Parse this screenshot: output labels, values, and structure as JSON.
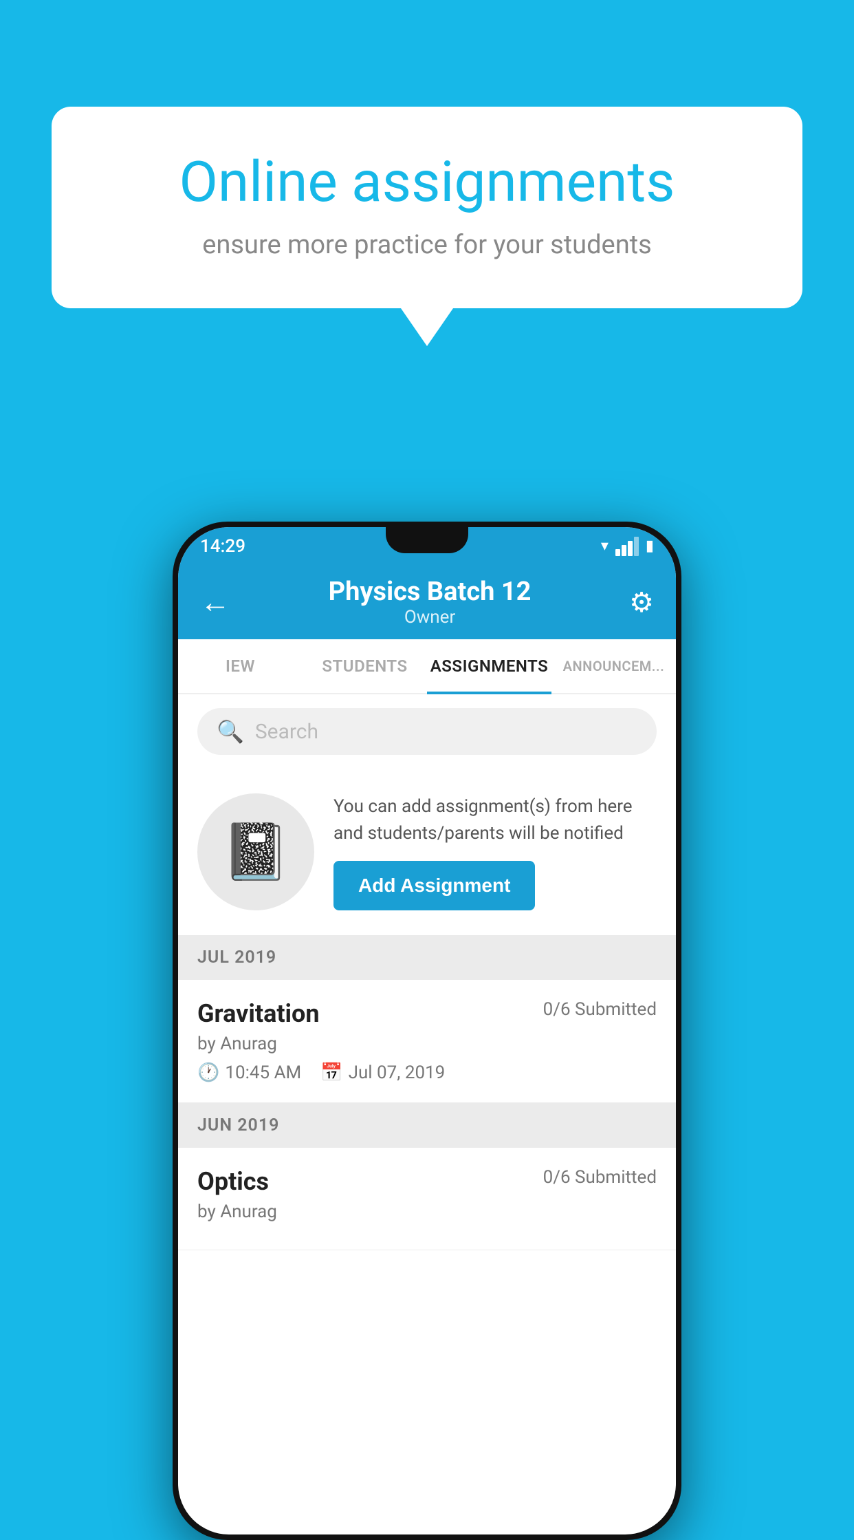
{
  "background_color": "#17b8e8",
  "speech_bubble": {
    "title": "Online assignments",
    "subtitle": "ensure more practice for your students"
  },
  "phone": {
    "status_bar": {
      "time": "14:29"
    },
    "app_bar": {
      "title": "Physics Batch 12",
      "subtitle": "Owner",
      "back_label": "←",
      "settings_label": "⚙"
    },
    "tabs": [
      {
        "label": "IEW",
        "active": false
      },
      {
        "label": "STUDENTS",
        "active": false
      },
      {
        "label": "ASSIGNMENTS",
        "active": true
      },
      {
        "label": "ANNOUNCEM...",
        "active": false
      }
    ],
    "search": {
      "placeholder": "Search"
    },
    "promo": {
      "text": "You can add assignment(s) from here and students/parents will be notified",
      "button_label": "Add Assignment"
    },
    "sections": [
      {
        "header": "JUL 2019",
        "assignments": [
          {
            "name": "Gravitation",
            "submitted": "0/6 Submitted",
            "author": "by Anurag",
            "time": "10:45 AM",
            "date": "Jul 07, 2019"
          }
        ]
      },
      {
        "header": "JUN 2019",
        "assignments": [
          {
            "name": "Optics",
            "submitted": "0/6 Submitted",
            "author": "by Anurag",
            "time": "",
            "date": ""
          }
        ]
      }
    ]
  }
}
